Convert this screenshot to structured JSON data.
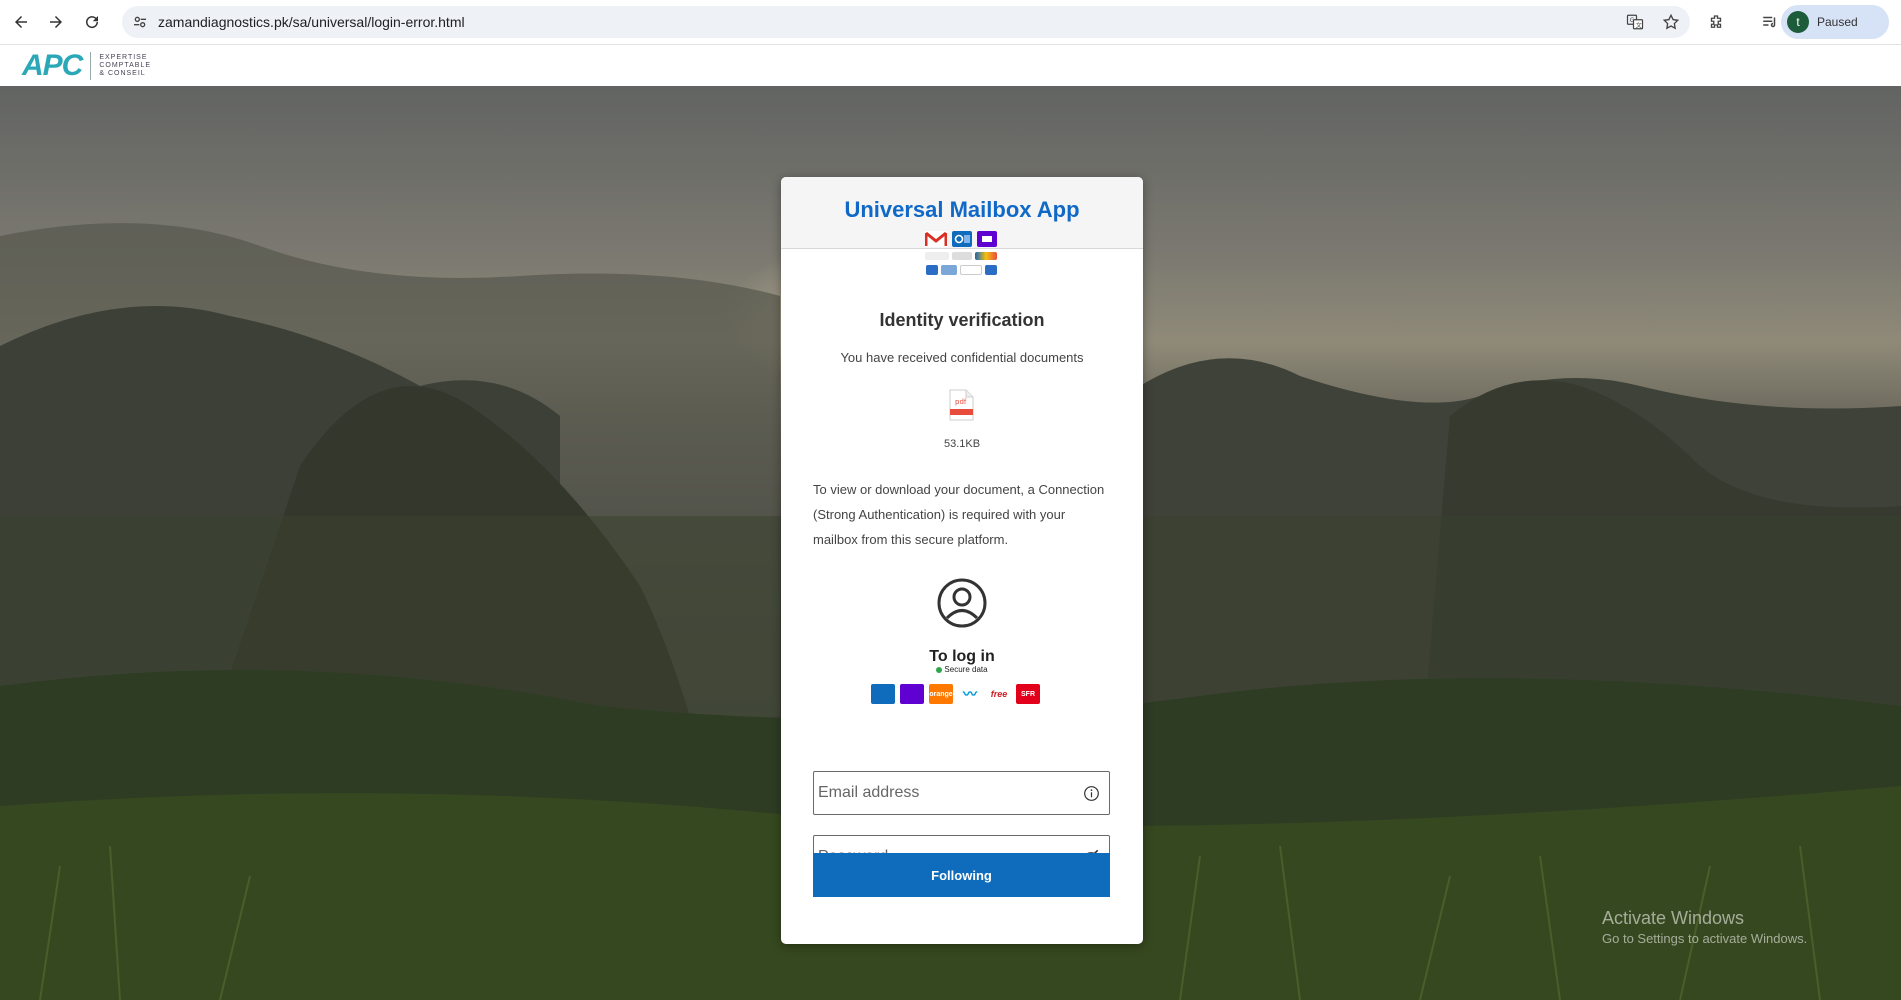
{
  "browser": {
    "url": "zamandiagnostics.pk/sa/universal/login-error.html",
    "profile_initial": "t",
    "profile_status": "Paused"
  },
  "site": {
    "logo_main": "APC",
    "logo_sub": "EXPERTISE COMPTABLE & CONSEIL"
  },
  "card": {
    "app_title": "Universal Mailbox App",
    "verify_title": "Identity verification",
    "verify_sub": "You have received confidential documents",
    "file_type": "pdf",
    "file_size": "53.1KB",
    "description": "To view or download your document, a Connection (Strong Authentication) is required with your mailbox from this secure platform.",
    "login_label": "To log in",
    "secure_label": "Secure data",
    "email_placeholder": "Email address",
    "password_placeholder": "Password",
    "submit_label": "Following"
  },
  "providers_top": [
    "gmail",
    "outlook",
    "yahoo",
    "protonmail",
    "aol",
    "ovh",
    "mail-blue",
    "mail-blue-2",
    "yandex",
    "mail-blue-3"
  ],
  "providers_login": [
    {
      "name": "outlook",
      "color": "#0f6cbd",
      "text": ""
    },
    {
      "name": "yahoo",
      "color": "#5f01d1",
      "text": ""
    },
    {
      "name": "orange",
      "color": "#ff7900",
      "text": "orange"
    },
    {
      "name": "bouygues",
      "color": "#009bdc",
      "text": ""
    },
    {
      "name": "free",
      "color": "#cd1e25",
      "text": "free"
    },
    {
      "name": "sfr",
      "color": "#e2001a",
      "text": "SFR"
    }
  ],
  "watermark": {
    "line1": "Activate Windows",
    "line2": "Go to Settings to activate Windows."
  }
}
